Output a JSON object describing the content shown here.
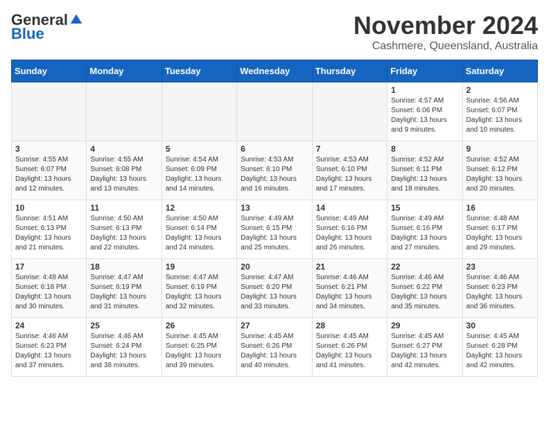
{
  "header": {
    "logo_general": "General",
    "logo_blue": "Blue",
    "month_title": "November 2024",
    "location": "Cashmere, Queensland, Australia"
  },
  "days_of_week": [
    "Sunday",
    "Monday",
    "Tuesday",
    "Wednesday",
    "Thursday",
    "Friday",
    "Saturday"
  ],
  "weeks": [
    [
      {
        "day": "",
        "info": ""
      },
      {
        "day": "",
        "info": ""
      },
      {
        "day": "",
        "info": ""
      },
      {
        "day": "",
        "info": ""
      },
      {
        "day": "",
        "info": ""
      },
      {
        "day": "1",
        "info": "Sunrise: 4:57 AM\nSunset: 6:06 PM\nDaylight: 13 hours and 9 minutes."
      },
      {
        "day": "2",
        "info": "Sunrise: 4:56 AM\nSunset: 6:07 PM\nDaylight: 13 hours and 10 minutes."
      }
    ],
    [
      {
        "day": "3",
        "info": "Sunrise: 4:55 AM\nSunset: 6:07 PM\nDaylight: 13 hours and 12 minutes."
      },
      {
        "day": "4",
        "info": "Sunrise: 4:55 AM\nSunset: 6:08 PM\nDaylight: 13 hours and 13 minutes."
      },
      {
        "day": "5",
        "info": "Sunrise: 4:54 AM\nSunset: 6:09 PM\nDaylight: 13 hours and 14 minutes."
      },
      {
        "day": "6",
        "info": "Sunrise: 4:53 AM\nSunset: 6:10 PM\nDaylight: 13 hours and 16 minutes."
      },
      {
        "day": "7",
        "info": "Sunrise: 4:53 AM\nSunset: 6:10 PM\nDaylight: 13 hours and 17 minutes."
      },
      {
        "day": "8",
        "info": "Sunrise: 4:52 AM\nSunset: 6:11 PM\nDaylight: 13 hours and 18 minutes."
      },
      {
        "day": "9",
        "info": "Sunrise: 4:52 AM\nSunset: 6:12 PM\nDaylight: 13 hours and 20 minutes."
      }
    ],
    [
      {
        "day": "10",
        "info": "Sunrise: 4:51 AM\nSunset: 6:13 PM\nDaylight: 13 hours and 21 minutes."
      },
      {
        "day": "11",
        "info": "Sunrise: 4:50 AM\nSunset: 6:13 PM\nDaylight: 13 hours and 22 minutes."
      },
      {
        "day": "12",
        "info": "Sunrise: 4:50 AM\nSunset: 6:14 PM\nDaylight: 13 hours and 24 minutes."
      },
      {
        "day": "13",
        "info": "Sunrise: 4:49 AM\nSunset: 6:15 PM\nDaylight: 13 hours and 25 minutes."
      },
      {
        "day": "14",
        "info": "Sunrise: 4:49 AM\nSunset: 6:16 PM\nDaylight: 13 hours and 26 minutes."
      },
      {
        "day": "15",
        "info": "Sunrise: 4:49 AM\nSunset: 6:16 PM\nDaylight: 13 hours and 27 minutes."
      },
      {
        "day": "16",
        "info": "Sunrise: 4:48 AM\nSunset: 6:17 PM\nDaylight: 13 hours and 29 minutes."
      }
    ],
    [
      {
        "day": "17",
        "info": "Sunrise: 4:48 AM\nSunset: 6:18 PM\nDaylight: 13 hours and 30 minutes."
      },
      {
        "day": "18",
        "info": "Sunrise: 4:47 AM\nSunset: 6:19 PM\nDaylight: 13 hours and 31 minutes."
      },
      {
        "day": "19",
        "info": "Sunrise: 4:47 AM\nSunset: 6:19 PM\nDaylight: 13 hours and 32 minutes."
      },
      {
        "day": "20",
        "info": "Sunrise: 4:47 AM\nSunset: 6:20 PM\nDaylight: 13 hours and 33 minutes."
      },
      {
        "day": "21",
        "info": "Sunrise: 4:46 AM\nSunset: 6:21 PM\nDaylight: 13 hours and 34 minutes."
      },
      {
        "day": "22",
        "info": "Sunrise: 4:46 AM\nSunset: 6:22 PM\nDaylight: 13 hours and 35 minutes."
      },
      {
        "day": "23",
        "info": "Sunrise: 4:46 AM\nSunset: 6:23 PM\nDaylight: 13 hours and 36 minutes."
      }
    ],
    [
      {
        "day": "24",
        "info": "Sunrise: 4:46 AM\nSunset: 6:23 PM\nDaylight: 13 hours and 37 minutes."
      },
      {
        "day": "25",
        "info": "Sunrise: 4:46 AM\nSunset: 6:24 PM\nDaylight: 13 hours and 38 minutes."
      },
      {
        "day": "26",
        "info": "Sunrise: 4:45 AM\nSunset: 6:25 PM\nDaylight: 13 hours and 39 minutes."
      },
      {
        "day": "27",
        "info": "Sunrise: 4:45 AM\nSunset: 6:26 PM\nDaylight: 13 hours and 40 minutes."
      },
      {
        "day": "28",
        "info": "Sunrise: 4:45 AM\nSunset: 6:26 PM\nDaylight: 13 hours and 41 minutes."
      },
      {
        "day": "29",
        "info": "Sunrise: 4:45 AM\nSunset: 6:27 PM\nDaylight: 13 hours and 42 minutes."
      },
      {
        "day": "30",
        "info": "Sunrise: 4:45 AM\nSunset: 6:28 PM\nDaylight: 13 hours and 42 minutes."
      }
    ]
  ]
}
